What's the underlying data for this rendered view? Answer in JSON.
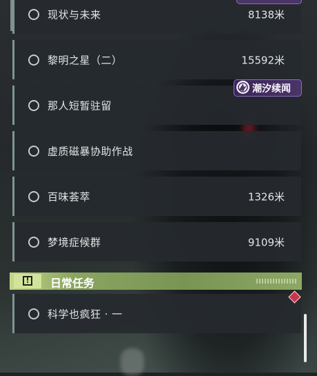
{
  "tasks": [
    {
      "title": "现状与未来",
      "distance": "8138米"
    },
    {
      "title": "黎明之星（二）",
      "distance": "15592米"
    },
    {
      "title": "那人短暂驻留",
      "distance": ""
    },
    {
      "title": "虚质磁暴协助作战",
      "distance": ""
    },
    {
      "title": "百味荟萃",
      "distance": "1326米"
    },
    {
      "title": "梦境症候群",
      "distance": "9109米"
    }
  ],
  "badge": {
    "label": "潮汐续闻",
    "icon": "tidal-sequel-icon"
  },
  "daily_section": {
    "title": "日常任务",
    "icon": "exclamation-icon"
  },
  "daily_tasks": [
    {
      "title": "科学也疯狂 · 一",
      "distance": ""
    }
  ],
  "colors": {
    "section_accent": "#8aa462",
    "badge_accent": "#8c6cc4",
    "tracked_marker": "#c8364a"
  }
}
